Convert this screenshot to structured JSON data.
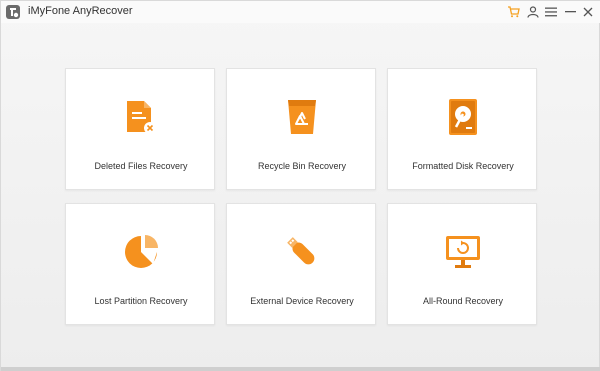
{
  "app": {
    "title": "iMyFone AnyRecover"
  },
  "titlebar_icons": [
    "cart-icon",
    "user-icon",
    "menu-icon",
    "minimize-icon",
    "close-icon"
  ],
  "colors": {
    "accent": "#f5911e",
    "accent_dark": "#e07b0f",
    "title_cart": "#f5a020"
  },
  "cards": [
    {
      "label": "Deleted Files Recovery",
      "icon": "deleted-file-icon"
    },
    {
      "label": "Recycle Bin Recovery",
      "icon": "recycle-bin-icon"
    },
    {
      "label": "Formatted Disk Recovery",
      "icon": "formatted-disk-icon"
    },
    {
      "label": "Lost Partition Recovery",
      "icon": "lost-partition-icon"
    },
    {
      "label": "External Device Recovery",
      "icon": "external-device-icon"
    },
    {
      "label": "All-Round Recovery",
      "icon": "all-round-icon"
    }
  ]
}
